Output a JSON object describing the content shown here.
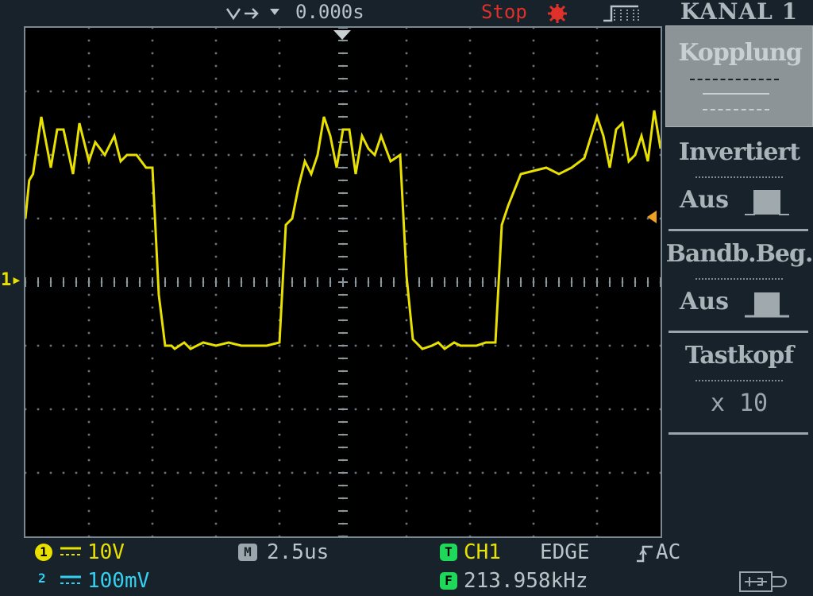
{
  "header": {
    "trigger_position": "0.000s",
    "run_state": "Stop",
    "menu_title": "KANAL 1"
  },
  "menu": {
    "items": [
      {
        "label": "Kopplung",
        "value": ""
      },
      {
        "label": "Invertiert",
        "value": "Aus"
      },
      {
        "label": "Bandb.Beg.",
        "value": "Aus"
      },
      {
        "label": "Tastkopf",
        "value": "x 10"
      }
    ]
  },
  "channel_marker": "1",
  "status": {
    "ch1_badge": "1",
    "ch1_scale": "10V",
    "ch2_badge": "2",
    "ch2_scale": "100mV",
    "timebase_badge": "M",
    "timebase": "2.5us",
    "trigger_badge": "T",
    "trigger_source": "CH1",
    "trigger_type": "EDGE",
    "trigger_coupling": "AC",
    "freq_badge": "F",
    "frequency": "213.958kHz"
  },
  "colors": {
    "ch1": "#e8e000",
    "ch2": "#33d0f0",
    "stop": "#e0302a",
    "badge_green": "#1fd85a"
  },
  "chart_data": {
    "type": "line",
    "title": "",
    "xlabel": "",
    "ylabel": "",
    "x_divisions": 10,
    "y_divisions": 8,
    "series": [
      {
        "name": "",
        "x_div": [
          0,
          0.06,
          0.12,
          0.25,
          0.4,
          0.5,
          0.6,
          0.75,
          0.85,
          1.0,
          1.1,
          1.25,
          1.4,
          1.5,
          1.6,
          1.75,
          1.9,
          2.0,
          2.1,
          2.2,
          2.3,
          2.35,
          2.5,
          2.6,
          2.8,
          3.0,
          3.2,
          3.4,
          3.6,
          3.8,
          4.0,
          4.1,
          4.2,
          4.3,
          4.4,
          4.5,
          4.6,
          4.7,
          4.8,
          4.9,
          5.0,
          5.1,
          5.2,
          5.3,
          5.4,
          5.5,
          5.6,
          5.75,
          5.9,
          6.0,
          6.1,
          6.25,
          6.4,
          6.5,
          6.6,
          6.75,
          6.85,
          7.0,
          7.1,
          7.25,
          7.4,
          7.5,
          7.6,
          7.8,
          8.0,
          8.2,
          8.4,
          8.6,
          8.8,
          9.0,
          9.1,
          9.2,
          9.3,
          9.4,
          9.5,
          9.6,
          9.7,
          9.8,
          9.9,
          10.0
        ],
        "y_div": [
          1.0,
          1.6,
          1.7,
          2.6,
          1.8,
          2.4,
          2.4,
          1.7,
          2.5,
          1.9,
          2.2,
          2.0,
          2.3,
          1.9,
          2.0,
          2.0,
          1.8,
          1.8,
          -0.2,
          -1.0,
          -1.0,
          -1.05,
          -0.95,
          -1.05,
          -0.95,
          -1.0,
          -0.95,
          -1.0,
          -1.0,
          -1.0,
          -0.95,
          0.9,
          1.0,
          1.5,
          1.9,
          1.7,
          2.0,
          2.6,
          2.3,
          1.8,
          2.4,
          2.4,
          1.7,
          2.3,
          2.1,
          2.0,
          2.3,
          1.9,
          2.0,
          0.1,
          -0.9,
          -1.05,
          -1.0,
          -0.95,
          -1.05,
          -0.95,
          -1.0,
          -1.0,
          -1.0,
          -0.95,
          -0.95,
          0.9,
          1.2,
          1.7,
          1.75,
          1.8,
          1.7,
          1.8,
          1.95,
          2.6,
          2.3,
          1.8,
          2.4,
          2.5,
          1.9,
          2.0,
          2.3,
          1.9,
          2.7,
          2.1
        ]
      }
    ]
  }
}
